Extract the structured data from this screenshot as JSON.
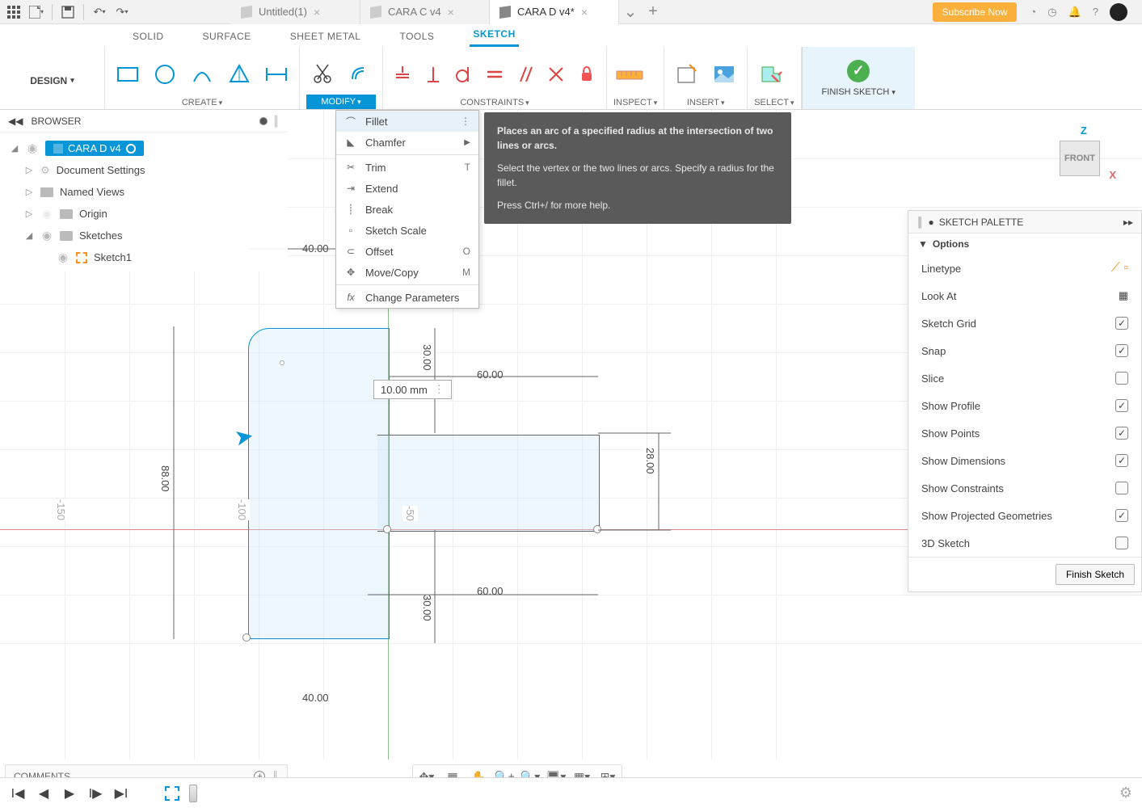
{
  "topbar": {
    "subscribe": "Subscribe Now"
  },
  "tabs": [
    {
      "label": "Untitled(1)",
      "active": false
    },
    {
      "label": "CARA C v4",
      "active": false
    },
    {
      "label": "CARA D v4*",
      "active": true
    }
  ],
  "workspace": {
    "label": "DESIGN"
  },
  "ribbonTabs": {
    "solid": "SOLID",
    "surface": "SURFACE",
    "sheetmetal": "SHEET METAL",
    "tools": "TOOLS",
    "sketch": "SKETCH"
  },
  "ribbonGroups": {
    "create": "CREATE",
    "modify": "MODIFY",
    "constraints": "CONSTRAINTS",
    "inspect": "INSPECT",
    "insert": "INSERT",
    "select": "SELECT",
    "finish": "FINISH SKETCH"
  },
  "browser": {
    "title": "BROWSER",
    "root": "CARA D v4",
    "items": {
      "docSettings": "Document Settings",
      "namedViews": "Named Views",
      "origin": "Origin",
      "sketches": "Sketches",
      "sketch1": "Sketch1"
    }
  },
  "modifyMenu": {
    "fillet": "Fillet",
    "chamfer": "Chamfer",
    "trim": "Trim",
    "trimKey": "T",
    "extend": "Extend",
    "break": "Break",
    "sketchScale": "Sketch Scale",
    "offset": "Offset",
    "offsetKey": "O",
    "moveCopy": "Move/Copy",
    "moveCopyKey": "M",
    "changeParams": "Change Parameters"
  },
  "tooltip": {
    "p1": "Places an arc of a specified radius at the intersection of two lines or arcs.",
    "p2": "Select the vertex or the two lines or arcs. Specify a radius for the fillet.",
    "p3": "Press Ctrl+/ for more help."
  },
  "palette": {
    "title": "SKETCH PALETTE",
    "section": "Options",
    "rows": {
      "linetype": "Linetype",
      "lookat": "Look At",
      "grid": "Sketch Grid",
      "snap": "Snap",
      "slice": "Slice",
      "profile": "Show Profile",
      "points": "Show Points",
      "dims": "Show Dimensions",
      "constraints": "Show Constraints",
      "projgeom": "Show Projected Geometries",
      "sketch3d": "3D Sketch"
    },
    "finish": "Finish Sketch"
  },
  "viewcube": {
    "z": "Z",
    "x": "X",
    "front": "FRONT"
  },
  "comments": {
    "label": "COMMENTS"
  },
  "dims": {
    "d40_top": "40.00",
    "d40_bot": "40.00",
    "d60_a": "60.00",
    "d60_b": "60.00",
    "d30_a": "30.00",
    "d30_b": "30.00",
    "d28": "28.00",
    "d88": "88.00",
    "r150": "-150",
    "r100": "-100",
    "r50": "-50",
    "input": "10.00 mm"
  }
}
